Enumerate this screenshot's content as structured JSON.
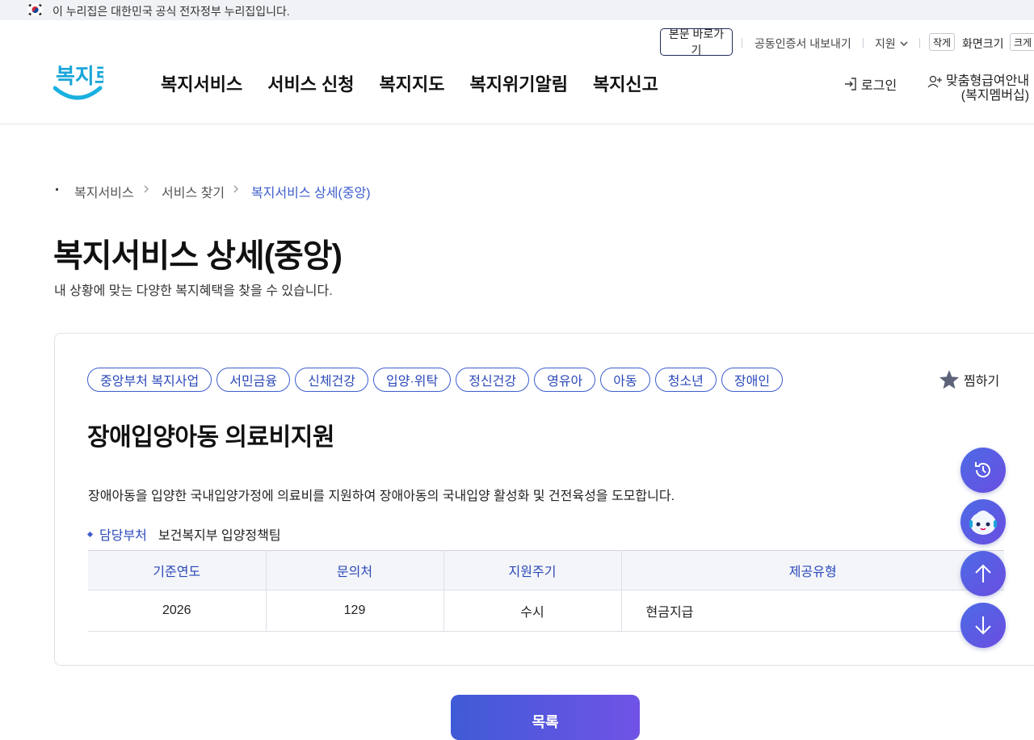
{
  "gov_banner": {
    "text": "이 누리집은 대한민국 공식 전자정부 누리집입니다."
  },
  "header": {
    "logo_text": "복지로",
    "util": {
      "skip": "본문 바로가기",
      "cert": "공동인증서 내보내기",
      "support": "지원",
      "size_small": "작게",
      "size_label": "화면크기",
      "size_large": "크게"
    },
    "gnb": [
      "복지서비스",
      "서비스 신청",
      "복지지도",
      "복지위기알림",
      "복지신고"
    ],
    "login": "로그인",
    "member_line1": "맞춤형급여안내",
    "member_line2": "(복지멤버십)"
  },
  "breadcrumb": {
    "items": [
      "복지서비스",
      "서비스 찾기"
    ],
    "current": "복지서비스 상세(중앙)"
  },
  "page": {
    "title": "복지서비스 상세(중앙)",
    "description": "내 상황에 맞는 다양한 복지혜택을 찾을 수 있습니다."
  },
  "service": {
    "tags": [
      "중앙부처 복지사업",
      "서민금융",
      "신체건강",
      "입양·위탁",
      "정신건강",
      "영유아",
      "아동",
      "청소년",
      "장애인"
    ],
    "favorite": "찜하기",
    "title": "장애입양아동 의료비지원",
    "description": "장애아동을 입양한 국내입양가정에 의료비를 지원하여 장애아동의 국내입양 활성화 및 건전육성을 도모합니다.",
    "dept_label": "담당부처",
    "dept_value": "보건복지부 입양정책팀",
    "table": {
      "headers": [
        "기준연도",
        "문의처",
        "지원주기",
        "제공유형"
      ],
      "row": [
        "2026",
        "129",
        "수시",
        "현금지급"
      ]
    }
  },
  "list_button": "목록",
  "colors": {
    "accent": "#3d5ccc",
    "fab_gradient_start": "#4c6be6",
    "fab_gradient_end": "#6a4de0"
  }
}
